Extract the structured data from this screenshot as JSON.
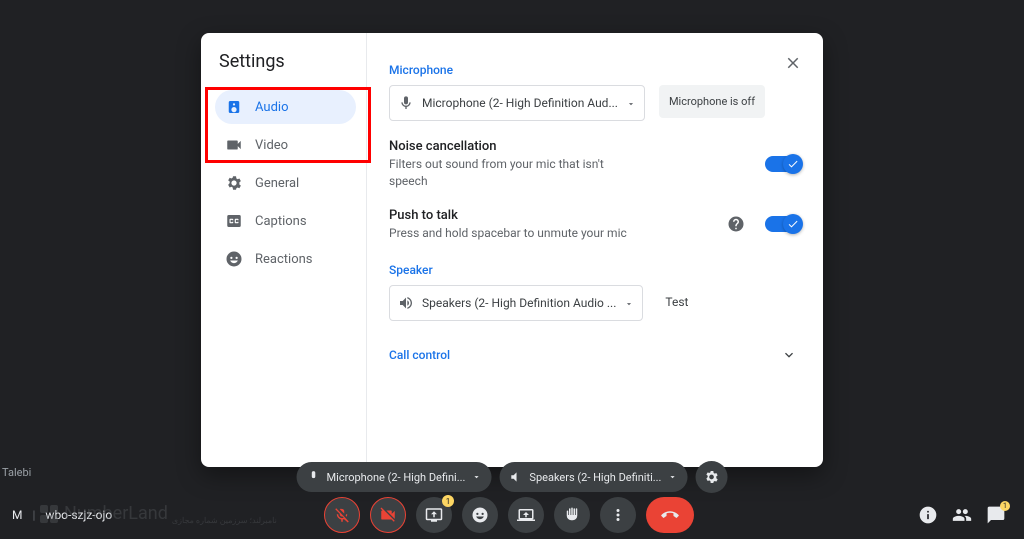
{
  "dialog": {
    "title": "Settings",
    "sidebar": [
      {
        "key": "audio",
        "label": "Audio",
        "active": true
      },
      {
        "key": "video",
        "label": "Video",
        "active": false
      },
      {
        "key": "general",
        "label": "General",
        "active": false
      },
      {
        "key": "captions",
        "label": "Captions",
        "active": false
      },
      {
        "key": "reactions",
        "label": "Reactions",
        "active": false
      }
    ],
    "audio": {
      "mic_section_label": "Microphone",
      "mic_dropdown": "Microphone (2- High Definition Aud...",
      "mic_status": "Microphone is off",
      "noise_title": "Noise cancellation",
      "noise_desc": "Filters out sound from your mic that isn't speech",
      "noise_on": true,
      "ptt_title": "Push to talk",
      "ptt_desc": "Press and hold spacebar to unmute your mic",
      "ptt_on": true,
      "speaker_section_label": "Speaker",
      "speaker_dropdown": "Speakers (2- High Definition Audio ...",
      "speaker_test": "Test",
      "call_control_label": "Call control"
    }
  },
  "bottom": {
    "mic_pill": "Microphone (2- High Defini...",
    "spk_pill": "Speakers (2- High Definiti...",
    "meeting_code_prefix": "M",
    "meeting_code": "wbo-szjz-ojo",
    "present_badge": "1",
    "chat_badge": "1"
  },
  "misc": {
    "talebi": "Talebi",
    "watermark": "NumberLand",
    "watermark_sub": "نامبرلند؛ سرزمین شماره مجازی"
  }
}
